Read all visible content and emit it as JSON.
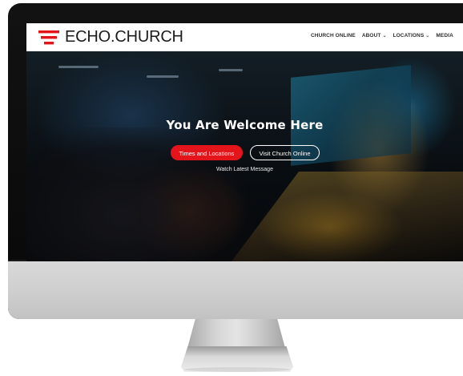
{
  "site": {
    "logo_text": "ECHO.CHURCH",
    "logo_icon": "three-red-bars-logo"
  },
  "nav": {
    "items": [
      {
        "label": "CHURCH ONLINE",
        "has_dropdown": false
      },
      {
        "label": "ABOUT",
        "has_dropdown": true
      },
      {
        "label": "LOCATIONS",
        "has_dropdown": true
      },
      {
        "label": "MEDIA",
        "has_dropdown": false
      }
    ],
    "dropdown_icon": "chevron-down-icon"
  },
  "hero": {
    "title": "You Are Welcome Here",
    "primary_button": "Times and Locations",
    "secondary_button": "Visit Church Online",
    "watch_link": "Watch Latest Message"
  },
  "colors": {
    "accent": "#e3151b",
    "header_bg": "#ffffff",
    "monitor_frame": "#0e0e0e",
    "monitor_chin": "#d4d4d4"
  }
}
